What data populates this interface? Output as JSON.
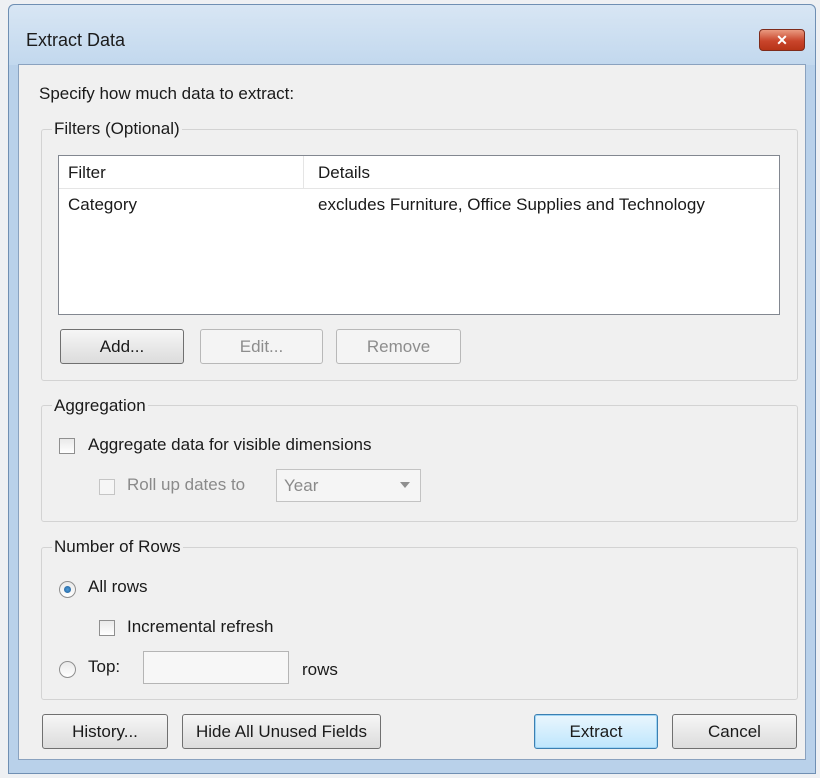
{
  "window": {
    "title": "Extract Data",
    "close_label": "✕"
  },
  "intro": "Specify how much data to extract:",
  "filters": {
    "legend": "Filters (Optional)",
    "columns": [
      "Filter",
      "Details"
    ],
    "rows": [
      {
        "filter": "Category",
        "details": "excludes Furniture, Office Supplies and Technology"
      }
    ],
    "add_label": "Add...",
    "edit_label": "Edit...",
    "remove_label": "Remove"
  },
  "aggregation": {
    "legend": "Aggregation",
    "aggregate_label": "Aggregate data for visible dimensions",
    "aggregate_checked": false,
    "rollup_label": "Roll up dates to",
    "rollup_checked": false,
    "rollup_value": "Year"
  },
  "rows_section": {
    "legend": "Number of Rows",
    "all_rows_label": "All rows",
    "all_rows_selected": true,
    "incremental_label": "Incremental refresh",
    "top_label": "Top:",
    "top_value": "",
    "rows_suffix": "rows"
  },
  "footer": {
    "history_label": "History...",
    "hide_unused_label": "Hide All Unused Fields",
    "extract_label": "Extract",
    "cancel_label": "Cancel"
  }
}
